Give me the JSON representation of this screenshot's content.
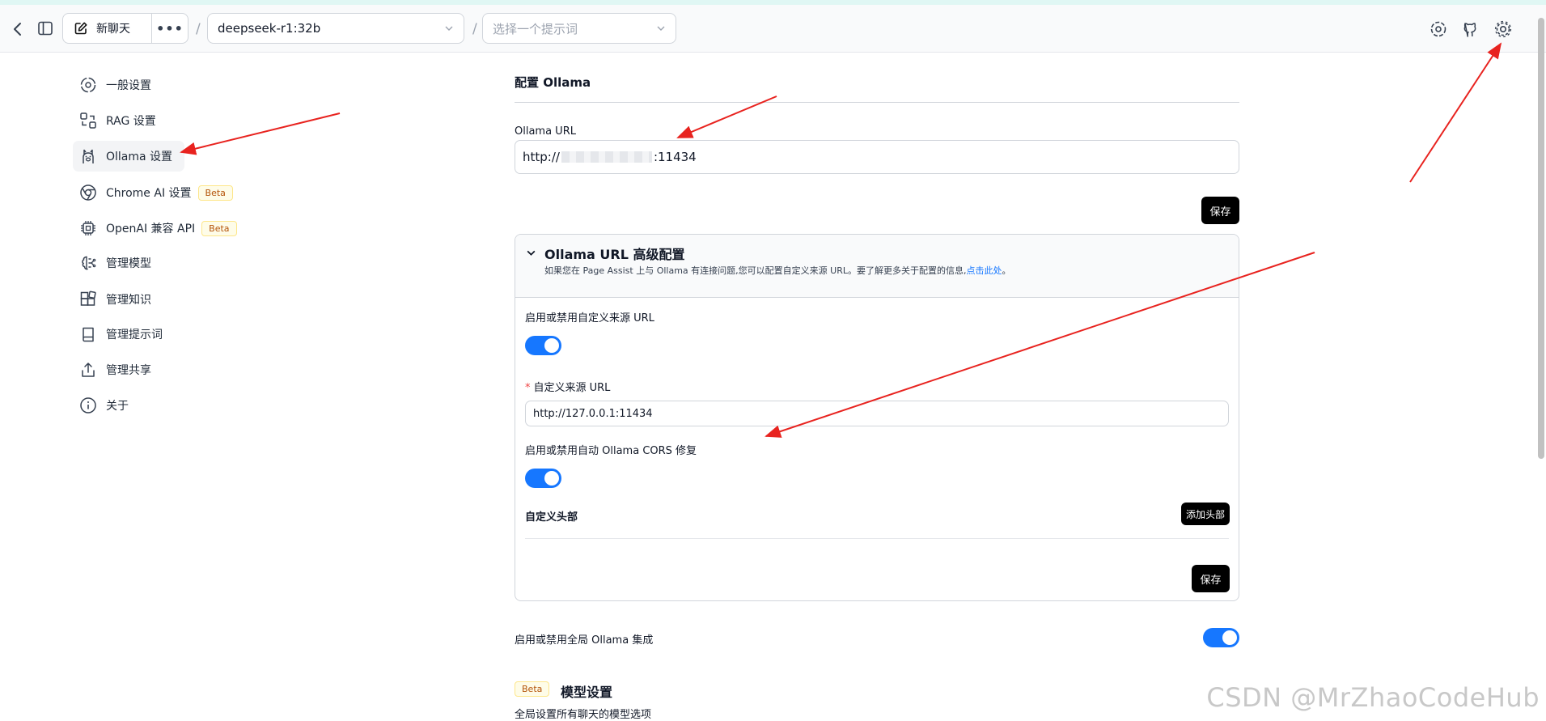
{
  "header": {
    "new_chat_label": "新聊天",
    "model_selected": "deepseek-r1:32b",
    "prompt_placeholder": "选择一个提示词",
    "separator": "/"
  },
  "sidebar": {
    "items": [
      {
        "label": "一般设置",
        "icon": "general-settings-icon"
      },
      {
        "label": "RAG 设置",
        "icon": "rag-icon"
      },
      {
        "label": "Ollama 设置",
        "icon": "ollama-llama-icon"
      },
      {
        "label": "Chrome AI 设置",
        "icon": "chrome-icon",
        "badge": "Beta"
      },
      {
        "label": "OpenAI 兼容 API",
        "icon": "chip-icon",
        "badge": "Beta"
      },
      {
        "label": "管理模型",
        "icon": "brain-icon"
      },
      {
        "label": "管理知识",
        "icon": "blocks-icon"
      },
      {
        "label": "管理提示词",
        "icon": "book-icon"
      },
      {
        "label": "管理共享",
        "icon": "share-icon"
      },
      {
        "label": "关于",
        "icon": "info-icon"
      }
    ]
  },
  "main": {
    "section_title": "配置 Ollama",
    "ollama_url_label": "Ollama URL",
    "ollama_url_prefix": "http://",
    "ollama_url_suffix": ":11434",
    "save_label": "保存",
    "advanced": {
      "title": "Ollama URL 高级配置",
      "description": "如果您在 Page Assist 上与 Ollama 有连接问题,您可以配置自定义来源 URL。要了解更多关于配置的信息,",
      "link_text": "点击此处",
      "description_end": "。",
      "toggle_custom_origin_label": "启用或禁用自定义来源 URL",
      "toggle_custom_origin_on": true,
      "custom_origin_label": "自定义来源 URL",
      "required_mark": "*",
      "custom_origin_value": "http://127.0.0.1:11434",
      "toggle_cors_label": "启用或禁用自动 Ollama CORS 修复",
      "toggle_cors_on": true,
      "custom_headers_label": "自定义头部",
      "add_header_label": "添加头部",
      "save_label": "保存"
    },
    "global_toggle_label": "启用或禁用全局 Ollama 集成",
    "global_toggle_on": true,
    "model_settings_badge": "Beta",
    "model_settings_title": "模型设置",
    "model_settings_desc": "全局设置所有聊天的模型选项"
  },
  "watermark": "CSDN @MrZhaoCodeHub",
  "colors": {
    "accent": "#1677ff",
    "link": "#1677ff",
    "annotation_arrow": "#e8231f"
  }
}
